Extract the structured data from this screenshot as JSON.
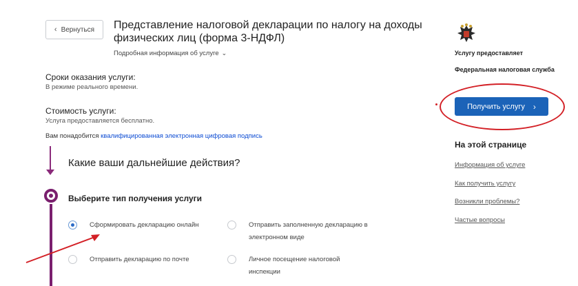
{
  "header": {
    "back_label": "Вернуться",
    "title": "Представление налоговой декларации по налогу на доходы физических лиц (форма 3-НДФЛ)",
    "more_info": "Подробная информация об услуге"
  },
  "service_terms": {
    "heading": "Сроки оказания услуги:",
    "text": "В режиме реального времени."
  },
  "service_cost": {
    "heading": "Стоимость услуги:",
    "text": "Услуга предоставляется бесплатно."
  },
  "signature": {
    "prefix": "Вам понадобится",
    "link": "квалифицированная электронная цифровая подпись"
  },
  "next_actions_title": "Какие ваши дальнейшие действия?",
  "step": {
    "title": "Выберите тип получения услуги",
    "options": [
      {
        "label": "Сформировать декларацию онлайн",
        "checked": true
      },
      {
        "label": "Отправить заполненную декларацию в электронном виде",
        "checked": false
      },
      {
        "label": "Отправить декларацию по почте",
        "checked": false
      },
      {
        "label": "Личное посещение налоговой инспекции",
        "checked": false
      }
    ]
  },
  "sidebar": {
    "provider_label": "Услугу предоставляет",
    "provider_name": "Федеральная налоговая служба",
    "get_service_button": "Получить услугу",
    "toc_title": "На этой странице",
    "toc_links": [
      "Информация об услуге",
      "Как получить услугу",
      "Возникли проблемы?",
      "Частые вопросы"
    ]
  },
  "colors": {
    "primary_button": "#1b63b8",
    "timeline": "#7a1f6e",
    "annotation_red": "#d32026",
    "link": "#0d4cd3"
  },
  "icons": [
    "chevron-left-icon",
    "chevron-down-icon",
    "chevron-right-icon",
    "coat-of-arms-icon",
    "radio-icon"
  ]
}
